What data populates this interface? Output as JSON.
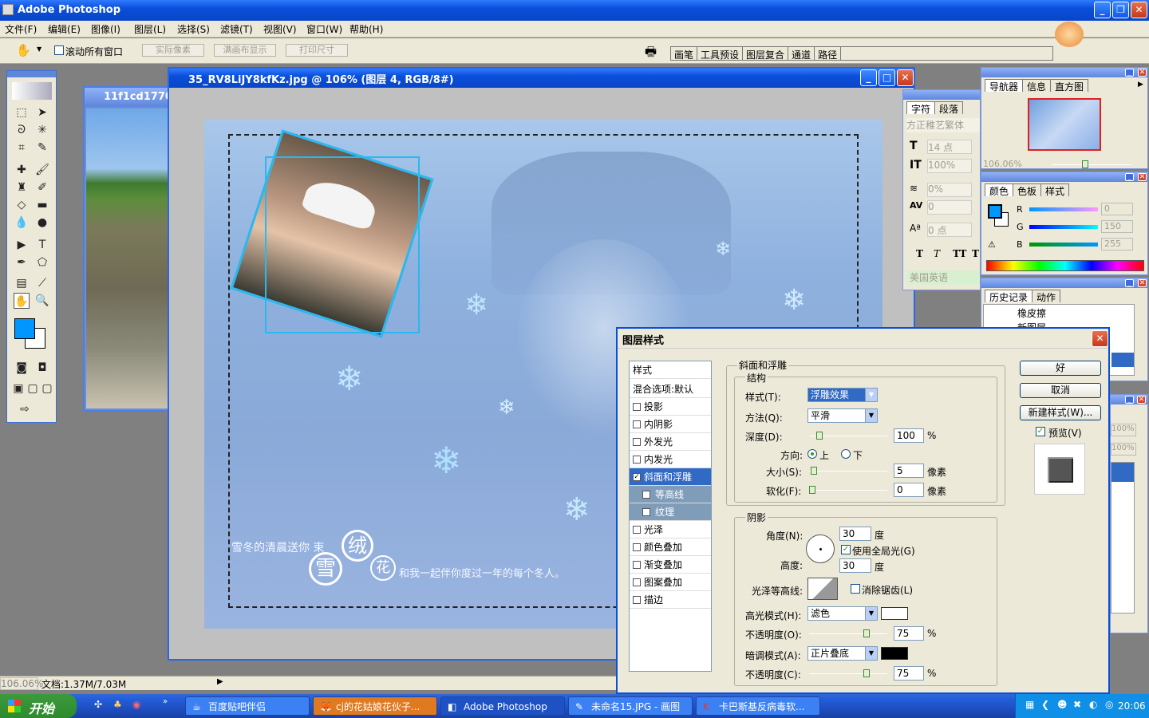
{
  "app": {
    "title": "Adobe Photoshop"
  },
  "menu": [
    "文件(F)",
    "编辑(E)",
    "图像(I)",
    "图层(L)",
    "选择(S)",
    "滤镜(T)",
    "视图(V)",
    "窗口(W)",
    "帮助(H)"
  ],
  "options": {
    "scroll_all": "滚动所有窗口",
    "actual_pixels": "实际像素",
    "fit_screen": "满画布显示",
    "print_size": "打印尺寸"
  },
  "well_tabs": [
    "画笔",
    "工具预设",
    "图层复合",
    "通道",
    "路径"
  ],
  "doc_secondary": {
    "title": "11f1cd1770"
  },
  "doc_main": {
    "title": "35_RV8LiJY8kfKz.jpg @ 106% (图层 4, RGB/8#)"
  },
  "canvas_text": {
    "line1": "雪冬的清晨送你  束",
    "circle1": "绒",
    "circle2": "雪",
    "circle3": "花",
    "line2": "和我一起伴你度过一年的每个冬人。"
  },
  "char_panel": {
    "tabs": [
      "字符",
      "段落"
    ],
    "font": "方正稚艺繁体",
    "size": "14 点",
    "leading_pct": "100%",
    "tracking_pct": "0%",
    "kerning": "0",
    "baseline": "0 点",
    "lang": "美国英语",
    "styles": [
      "T",
      "T",
      "TT",
      "T"
    ]
  },
  "navigator": {
    "tabs": [
      "导航器",
      "信息",
      "直方图"
    ],
    "zoom": "106.06%"
  },
  "color_panel": {
    "tabs": [
      "颜色",
      "色板",
      "样式"
    ],
    "r": "0",
    "g": "150",
    "b": "255",
    "fg": "#0096ff"
  },
  "history": {
    "tabs": [
      "历史记录",
      "动作"
    ],
    "items": [
      "橡皮擦",
      "新图层"
    ]
  },
  "layers_panel": {
    "opacity1": "100%",
    "opacity2": "100%"
  },
  "status": {
    "zoom": "106.06%",
    "doc": "文档:1.37M/7.03M"
  },
  "dialog": {
    "title": "图层样式",
    "ok": "好",
    "cancel": "取消",
    "new_style": "新建样式(W)...",
    "preview": "预览(V)",
    "styles_header": "样式",
    "blend_default": "混合选项:默认",
    "items": [
      {
        "label": "投影",
        "checked": false
      },
      {
        "label": "内阴影",
        "checked": false
      },
      {
        "label": "外发光",
        "checked": false
      },
      {
        "label": "内发光",
        "checked": false
      },
      {
        "label": "斜面和浮雕",
        "checked": true
      },
      {
        "label": "等高线",
        "checked": false
      },
      {
        "label": "纹理",
        "checked": false
      },
      {
        "label": "光泽",
        "checked": false
      },
      {
        "label": "颜色叠加",
        "checked": false
      },
      {
        "label": "渐变叠加",
        "checked": false
      },
      {
        "label": "图案叠加",
        "checked": false
      },
      {
        "label": "描边",
        "checked": false
      }
    ],
    "bevel": {
      "section": "斜面和浮雕",
      "structure": "结构",
      "style_label": "样式(T):",
      "style_val": "浮雕效果",
      "method_label": "方法(Q):",
      "method_val": "平滑",
      "depth_label": "深度(D):",
      "depth_val": "100",
      "depth_unit": "%",
      "dir_label": "方向:",
      "dir_up": "上",
      "dir_down": "下",
      "size_label": "大小(S):",
      "size_val": "5",
      "size_unit": "像素",
      "soften_label": "软化(F):",
      "soften_val": "0",
      "soften_unit": "像素",
      "depth_level": 0.1,
      "size_level": 0.02,
      "soften_level": 0.0
    },
    "shading": {
      "section": "阴影",
      "angle_label": "角度(N):",
      "angle_val": "30",
      "deg": "度",
      "global": "使用全局光(G)",
      "alt_label": "高度:",
      "alt_val": "30",
      "gloss_label": "光泽等高线:",
      "anti": "消除锯齿(L)",
      "hl_mode_label": "高光模式(H):",
      "hl_mode": "滤色",
      "hl_color": "#ffffff",
      "op1_label": "不透明度(O):",
      "op1_val": "75",
      "pct": "%",
      "sh_mode_label": "暗调模式(A):",
      "sh_mode": "正片叠底",
      "sh_color": "#000000",
      "op2_label": "不透明度(C):",
      "op2_val": "75",
      "op_level": 0.75
    }
  },
  "taskbar": {
    "start": "开始",
    "tasks": [
      "百度贴吧伴侣",
      "cj的花姑娘花伙子...",
      "Adobe Photoshop",
      "未命名15.JPG - 画图",
      "卡巴斯基反病毒软..."
    ],
    "clock": "20:06"
  }
}
